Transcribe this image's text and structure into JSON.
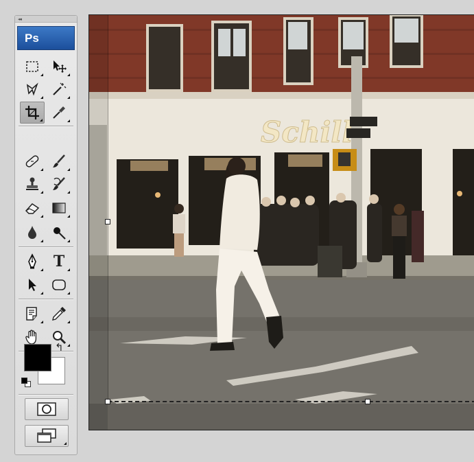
{
  "app": {
    "logo_text": "Ps"
  },
  "tools": [
    {
      "name": "rectangular-marquee-tool",
      "icon": "marquee-icon"
    },
    {
      "name": "move-tool",
      "icon": "move-icon"
    },
    {
      "name": "lasso-tool",
      "icon": "lasso-icon"
    },
    {
      "name": "magic-wand-tool",
      "icon": "magic-wand-icon"
    },
    {
      "name": "crop-tool",
      "icon": "crop-icon",
      "active": true
    },
    {
      "name": "eyedropper-slice-tool",
      "icon": "slice-icon"
    },
    {
      "name": "healing-brush-tool",
      "icon": "bandage-icon"
    },
    {
      "name": "brush-tool",
      "icon": "brush-icon"
    },
    {
      "name": "clone-stamp-tool",
      "icon": "stamp-icon"
    },
    {
      "name": "history-brush-tool",
      "icon": "history-brush-icon"
    },
    {
      "name": "eraser-tool",
      "icon": "eraser-icon"
    },
    {
      "name": "gradient-tool",
      "icon": "gradient-icon"
    },
    {
      "name": "blur-tool",
      "icon": "droplet-icon"
    },
    {
      "name": "dodge-tool",
      "icon": "dodge-icon"
    },
    {
      "name": "pen-tool",
      "icon": "pen-icon"
    },
    {
      "name": "type-tool",
      "icon": "type-icon",
      "glyph": "T"
    },
    {
      "name": "path-selection-tool",
      "icon": "arrow-icon"
    },
    {
      "name": "shape-tool",
      "icon": "rounded-rect-icon"
    },
    {
      "name": "notes-tool",
      "icon": "notes-icon"
    },
    {
      "name": "eyedropper-tool",
      "icon": "eyedropper-icon"
    },
    {
      "name": "hand-tool",
      "icon": "hand-icon"
    },
    {
      "name": "zoom-tool",
      "icon": "zoom-icon"
    }
  ],
  "colors": {
    "foreground": "#000000",
    "background": "#ffffff",
    "swap_glyph": "↰"
  },
  "modes": {
    "quick_mask": "quick-mask-icon",
    "screen_mode": "screen-mode-icon"
  },
  "canvas": {
    "image": "street corner photograph with man in white crossing the street",
    "crop_active": true
  }
}
